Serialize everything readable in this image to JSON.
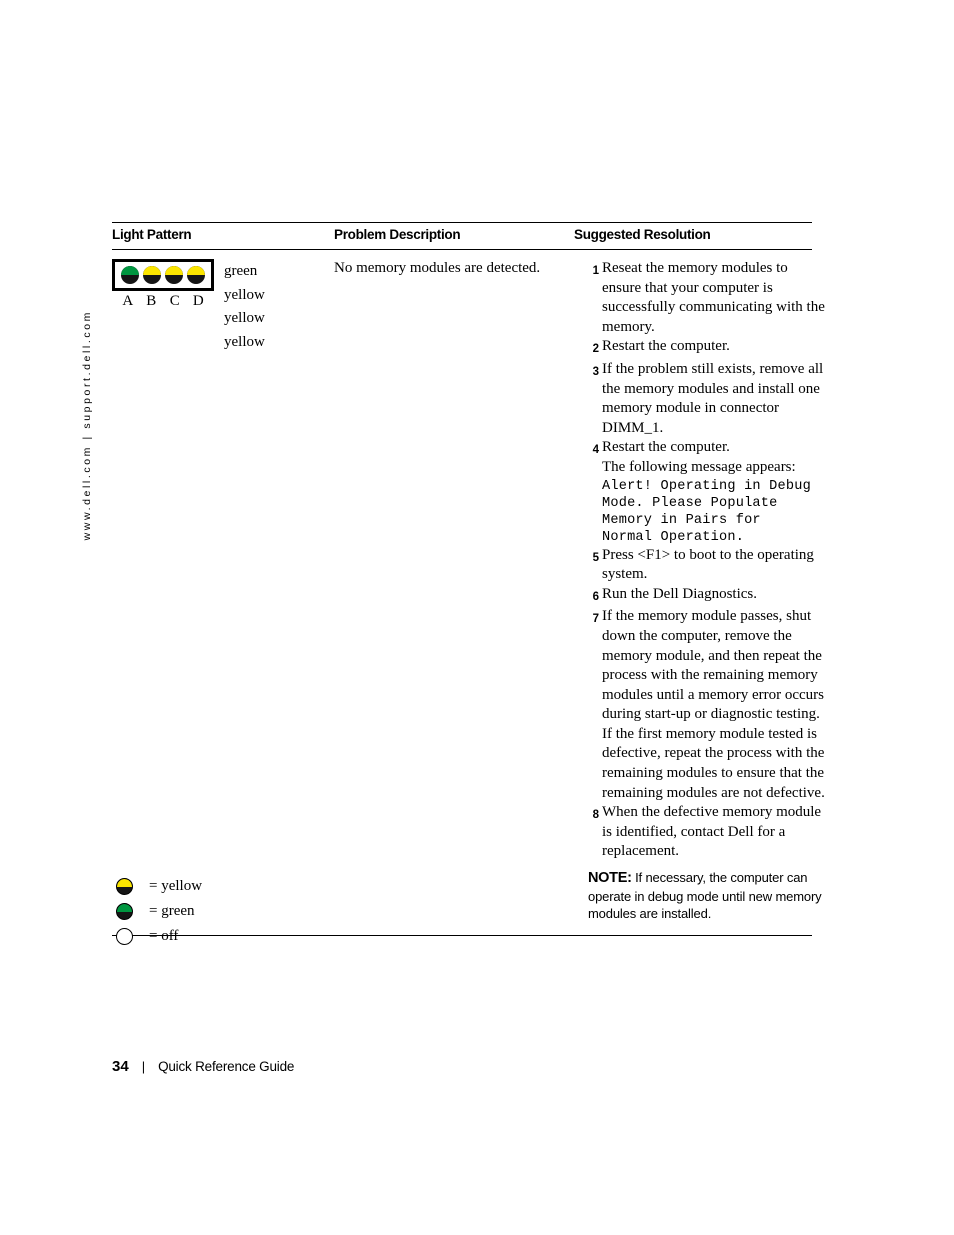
{
  "page": {
    "side_url": "www.dell.com | support.dell.com",
    "footer_page_number": "34",
    "footer_separator": "|",
    "footer_title": "Quick Reference Guide"
  },
  "table": {
    "headers": {
      "light_pattern": "Light Pattern",
      "problem_description": "Problem Description",
      "suggested_resolution": "Suggested Resolution"
    },
    "row": {
      "light_pattern": {
        "leds": [
          {
            "label": "A",
            "state": "green"
          },
          {
            "label": "B",
            "state": "yellow"
          },
          {
            "label": "C",
            "state": "yellow"
          },
          {
            "label": "D",
            "state": "yellow"
          }
        ],
        "color_labels": [
          "green",
          "yellow",
          "yellow",
          "yellow"
        ]
      },
      "problem_description": "No memory modules are detected.",
      "suggested_resolution": {
        "steps": [
          {
            "num": "1",
            "text": "Reseat the memory modules to ensure that your computer is successfully communicating with the memory."
          },
          {
            "num": "2",
            "text": "Restart the computer."
          },
          {
            "num": "3",
            "text": "If the problem still exists, remove all the memory modules and install one memory module in connector DIMM_1."
          },
          {
            "num": "4",
            "text": "Restart the computer.",
            "sub": "The following message appears:",
            "mono": "Alert! Operating in Debug\nMode. Please Populate\nMemory in Pairs for\nNormal Operation."
          },
          {
            "num": "5",
            "text": "Press <F1> to boot to the operating system."
          },
          {
            "num": "6",
            "text": "Run the Dell Diagnostics."
          },
          {
            "num": "7",
            "text": "If the memory module passes, shut down the computer, remove the memory module, and then repeat the process with the remaining memory modules until a memory error occurs during start-up or diagnostic testing.",
            "sub2": "If the first memory module tested is defective, repeat the process with the remaining modules to ensure that the remaining modules are not defective."
          },
          {
            "num": "8",
            "text": "When the defective memory module is identified, contact Dell for a replacement."
          }
        ],
        "note_label": "NOTE:",
        "note_text": " If necessary, the computer can operate in debug mode until new memory modules are installed."
      }
    }
  },
  "legend": {
    "items": [
      {
        "state": "yellow",
        "text": "= yellow"
      },
      {
        "state": "green",
        "text": "= green"
      },
      {
        "state": "off",
        "text": "= off"
      }
    ]
  },
  "colors": {
    "yellow": "#FBE500",
    "green": "#009640",
    "led_body": "#151515",
    "rule": "#000000"
  }
}
